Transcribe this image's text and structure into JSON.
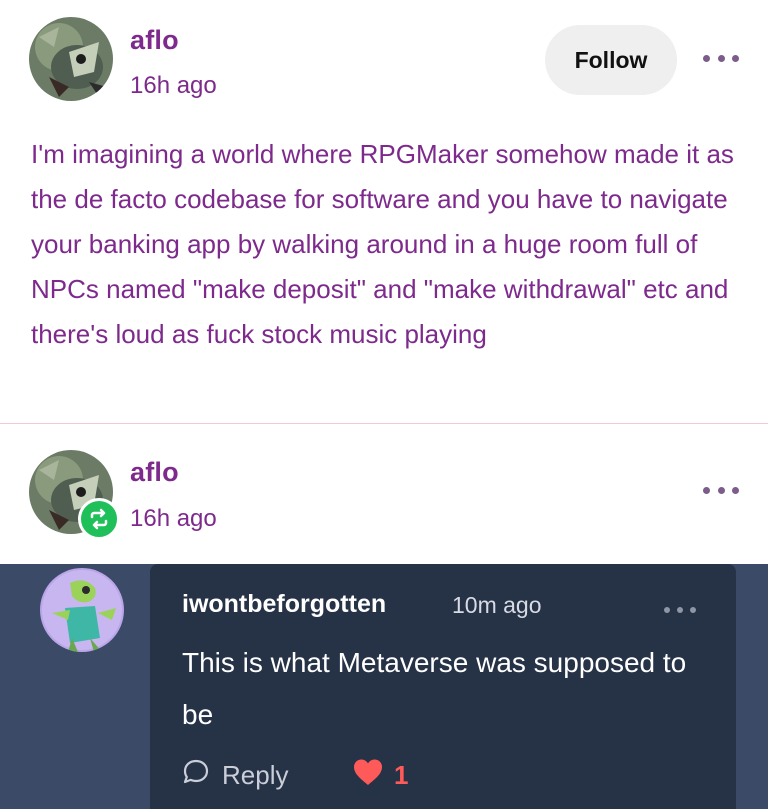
{
  "post": {
    "username": "aflo",
    "timestamp": "16h ago",
    "follow_label": "Follow",
    "more_icon": "more-dots-icon",
    "body": "I'm imagining a world where RPGMaker somehow made it as the de facto codebase for software and you have to navigate your banking app by walking around in a huge room full of NPCs named \"make deposit\" and \"make withdrawal\" etc and there's loud as fuck stock music playing"
  },
  "reblog": {
    "username": "aflo",
    "timestamp": "16h ago",
    "badge_icon": "reblog-icon",
    "more_icon": "more-dots-icon"
  },
  "comment": {
    "username": "iwontbeforgotten",
    "timestamp": "10m ago",
    "text": "This is what Metaverse was supposed to be",
    "reply_label": "Reply",
    "reply_icon": "speech-bubble-icon",
    "like_icon": "heart-icon",
    "like_count": "1",
    "more_icon": "more-dots-icon"
  },
  "colors": {
    "accent_text": "#7d2a8c",
    "reblog_badge": "#1fbf5a",
    "comment_bg": "#263246",
    "comment_outer_bg": "#3b4a66",
    "heart": "#ff5a5a"
  }
}
